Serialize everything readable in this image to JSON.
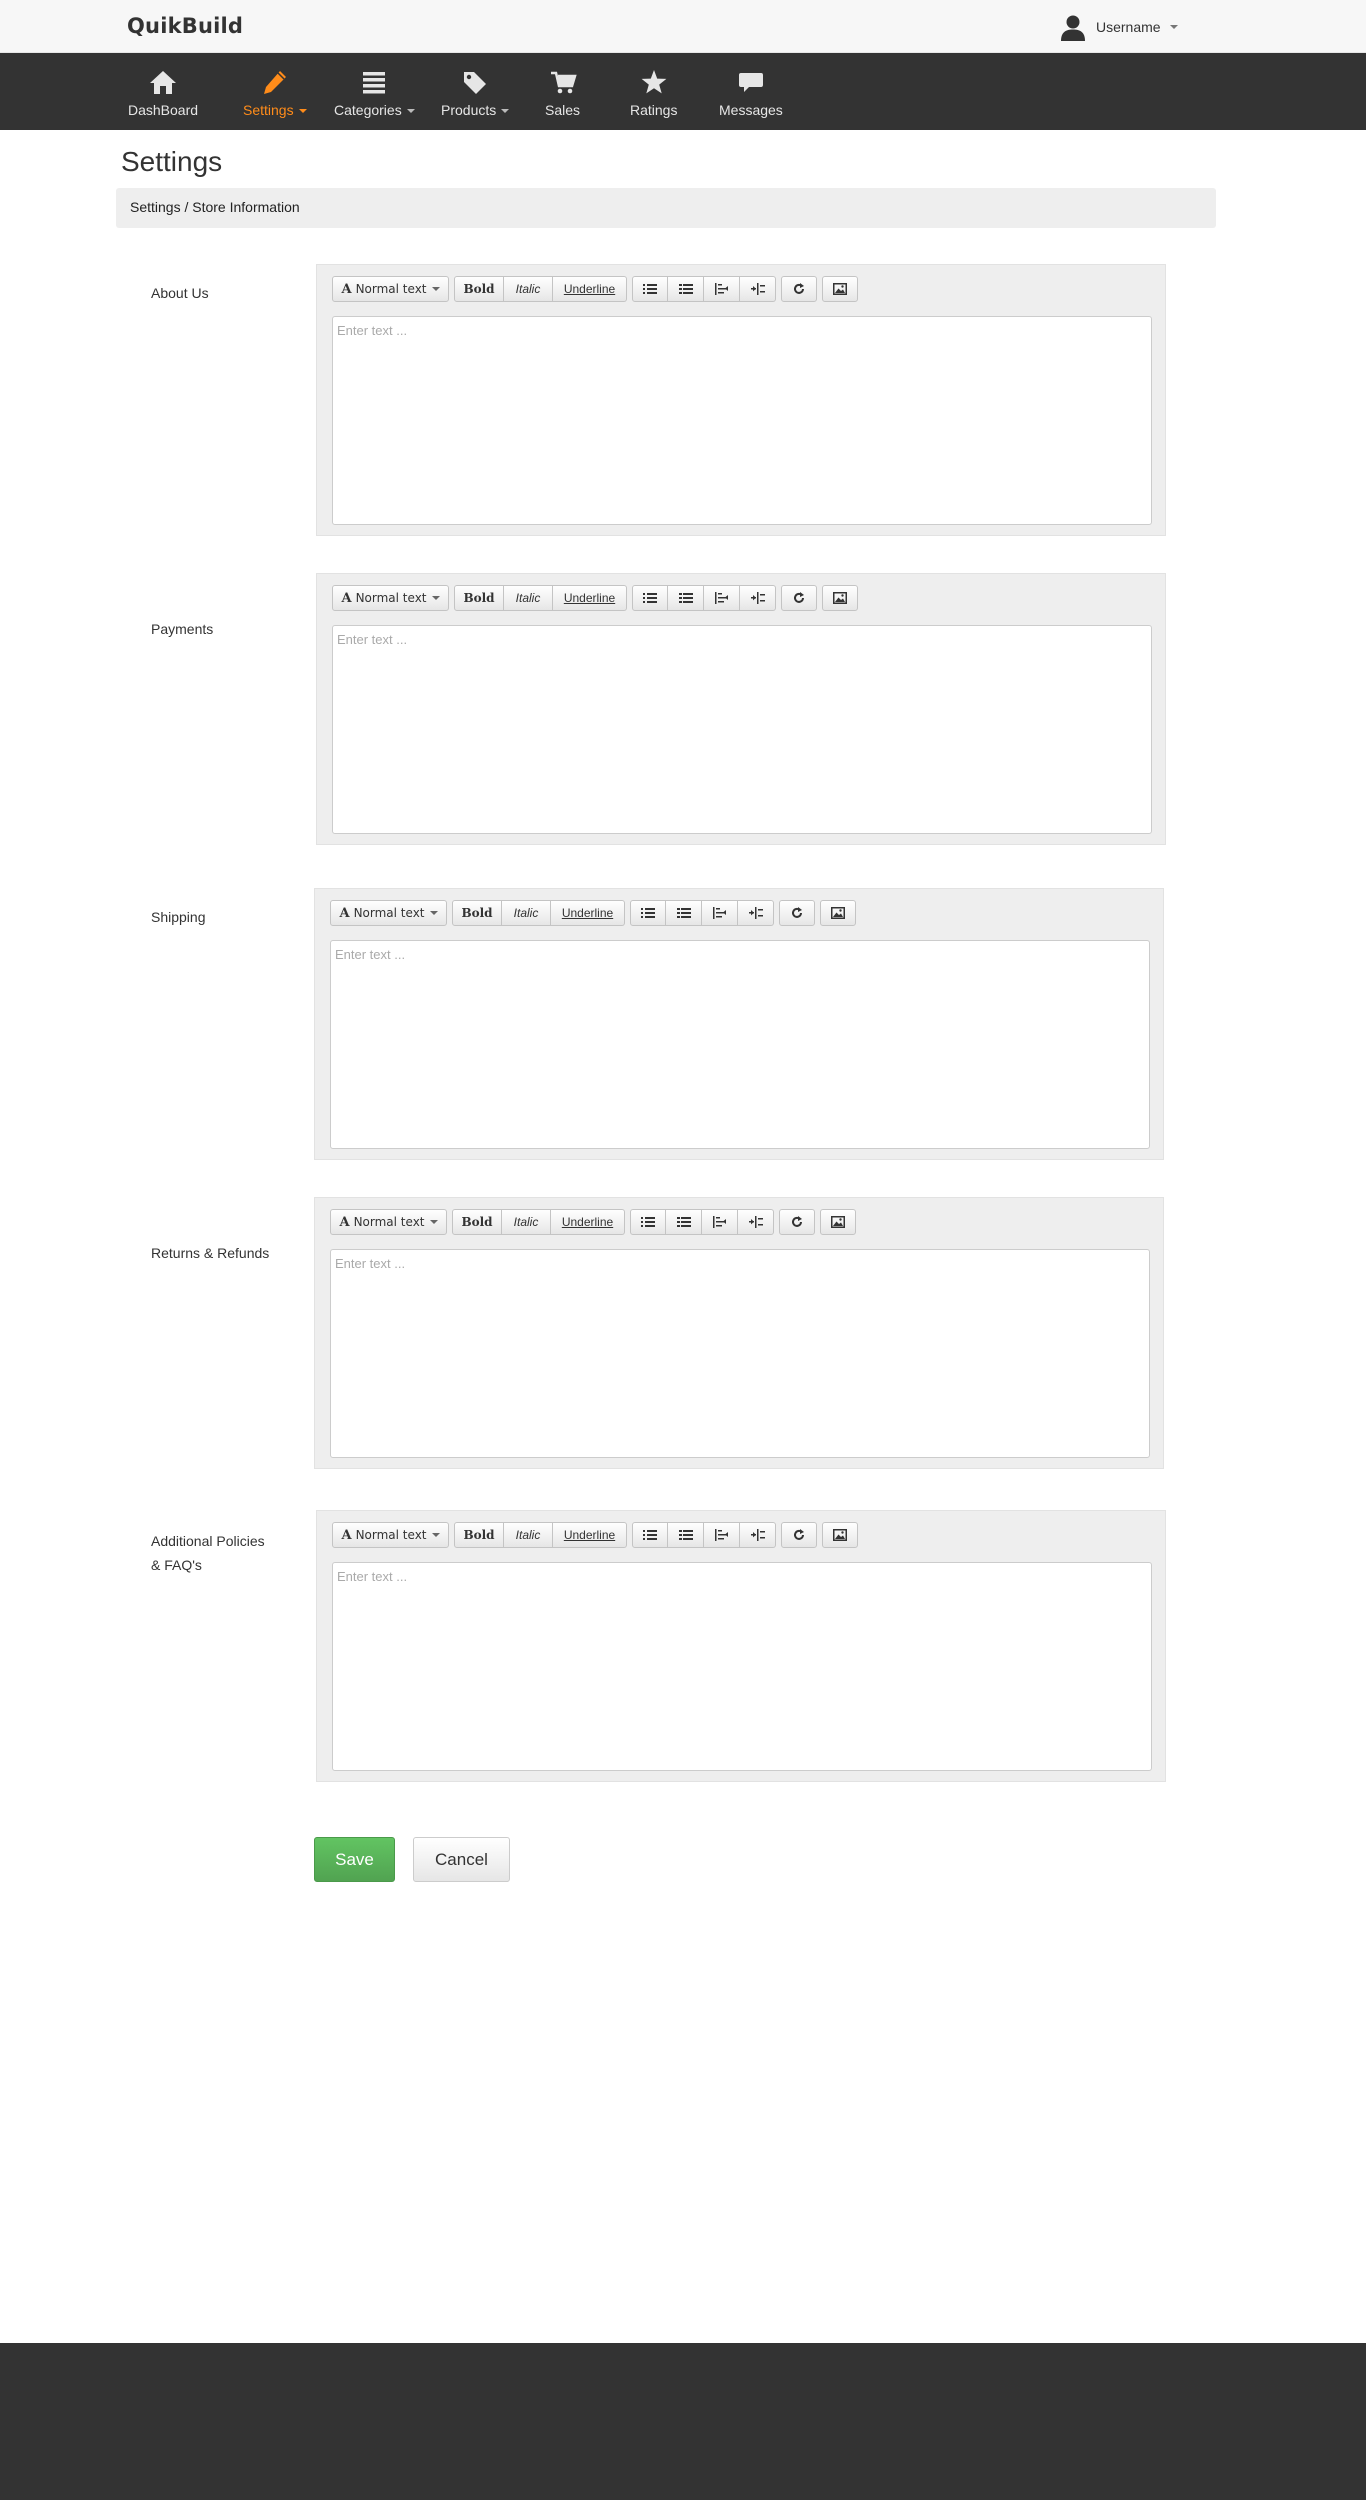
{
  "app": {
    "brand": "QuikBuild"
  },
  "user": {
    "name": "Username",
    "icon": "user-silhouette-icon"
  },
  "nav": {
    "items": [
      {
        "label": "DashBoard",
        "icon": "home-icon",
        "dropdown": false,
        "active": false
      },
      {
        "label": "Settings",
        "icon": "pencil-icon",
        "dropdown": true,
        "active": true
      },
      {
        "label": "Categories",
        "icon": "list-icon",
        "dropdown": true,
        "active": false
      },
      {
        "label": "Products",
        "icon": "tag-icon",
        "dropdown": true,
        "active": false
      },
      {
        "label": "Sales",
        "icon": "cart-icon",
        "dropdown": false,
        "active": false
      },
      {
        "label": "Ratings",
        "icon": "star-icon",
        "dropdown": false,
        "active": false
      },
      {
        "label": "Messages",
        "icon": "chat-bubble-icon",
        "dropdown": false,
        "active": false
      }
    ],
    "active_color": "#ff8c1a"
  },
  "page": {
    "title": "Settings",
    "breadcrumb": "Settings / Store Information"
  },
  "toolbar": {
    "font_label": "Normal text",
    "bold_label": "Bold",
    "italic_label": "Italic",
    "underline_label": "Underline",
    "icons": [
      "unordered-list-icon",
      "ordered-list-icon",
      "outdent-icon",
      "indent-icon",
      "undo-icon",
      "image-icon"
    ]
  },
  "sections": [
    {
      "label": "About Us",
      "placeholder": "Enter text ..."
    },
    {
      "label": "Payments",
      "placeholder": "Enter text ..."
    },
    {
      "label": "Shipping",
      "placeholder": "Enter text ..."
    },
    {
      "label": "Returns & Refunds",
      "placeholder": "Enter text ..."
    },
    {
      "label_line1": "Additional Policies",
      "label_line2": "& FAQ's",
      "placeholder": "Enter text ..."
    }
  ],
  "actions": {
    "save_label": "Save",
    "cancel_label": "Cancel"
  },
  "colors": {
    "navbar": "#333333",
    "save": "#5bb75b",
    "footer": "#333333"
  }
}
